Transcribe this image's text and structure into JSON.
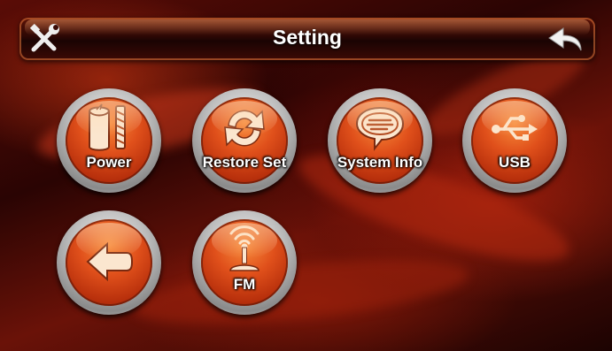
{
  "header": {
    "title": "Setting",
    "left_icon": "tools-icon",
    "right_icon": "back-arrow-icon"
  },
  "tiles": [
    {
      "label": "Power",
      "icon": "power-icon"
    },
    {
      "label": "Restore Set",
      "icon": "restore-icon"
    },
    {
      "label": "System Info",
      "icon": "speech-bubble-icon"
    },
    {
      "label": "USB",
      "icon": "usb-icon"
    },
    {
      "label": "",
      "icon": "back-arrow-icon"
    },
    {
      "label": "FM",
      "icon": "radio-antenna-icon"
    }
  ],
  "colors": {
    "accent": "#e0501b",
    "ring": "#bdbdbd",
    "text": "#ffffff"
  }
}
